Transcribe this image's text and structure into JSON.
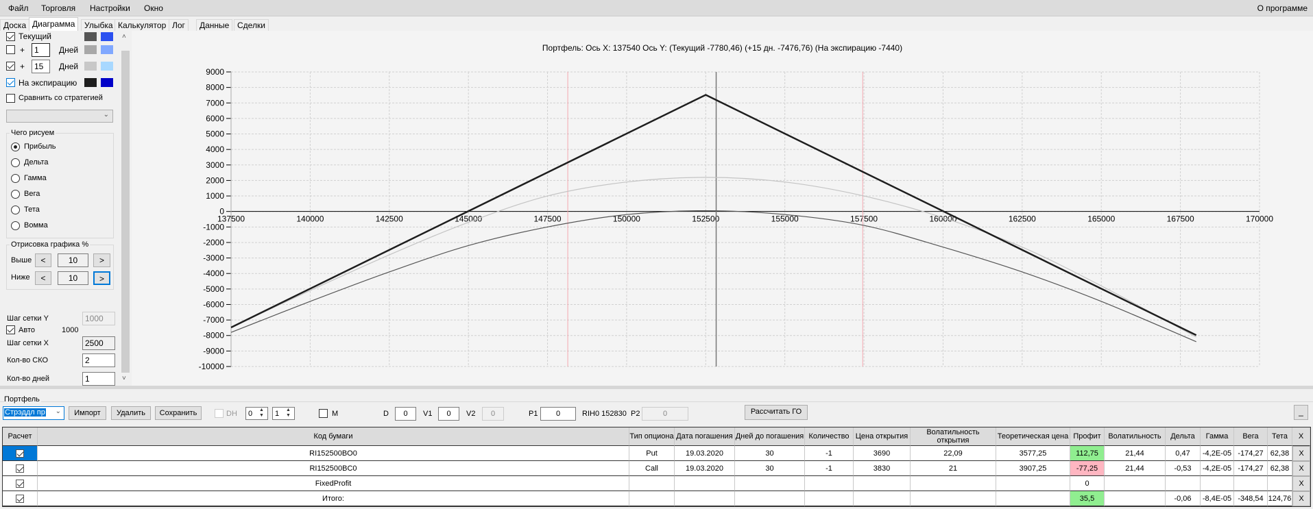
{
  "menu": {
    "items": [
      "Файл",
      "Торговля",
      "Настройки",
      "Окно"
    ],
    "about": "О программе"
  },
  "tabs": [
    "Доска",
    "Диаграмма",
    "Улыбка",
    "Калькулятор",
    "Лог",
    "Данные",
    "Сделки"
  ],
  "active_tab": "Диаграмма",
  "left": {
    "current_label": "Текущий",
    "plus": "+",
    "days1_value": "1",
    "days2_value": "15",
    "days_label": "Дней",
    "expiration_label": "На экспирацию",
    "compare_label": "Сравнить со стратегией",
    "colors": {
      "current": [
        "#555555",
        "#2b50f0"
      ],
      "days1": [
        "#a8a8a8",
        "#80a8ff"
      ],
      "days15": [
        "#c8c8c8",
        "#a8d8ff"
      ],
      "expiration": [
        "#1e1e1e",
        "#0000c8"
      ]
    },
    "what_group": "Чего рисуем",
    "radios": [
      "Прибыль",
      "Дельта",
      "Гамма",
      "Вега",
      "Тета",
      "Вомма"
    ],
    "radio_selected": "Прибыль",
    "draw_group": "Отрисовка графика %",
    "above_label": "Выше",
    "above_value": "10",
    "below_label": "Ниже",
    "below_value": "10",
    "prev": "<",
    "next": ">",
    "grid_y_label": "Шаг сетки Y",
    "grid_y_value": "1000",
    "auto_label": "Авто",
    "auto_value": "1000",
    "grid_x_label": "Шаг сетки X",
    "grid_x_value": "2500",
    "sko_label": "Кол-во СКО",
    "sko_value": "2",
    "days_count_label": "Кол-во дней",
    "days_count_value": "1"
  },
  "chart_data": {
    "type": "line",
    "title": "Портфель: Ось X: 137540 Ось Y:  (Текущий -7780,46)  (+15 дн. -7476,76)  (На экспирацию -7440)",
    "xlim": [
      137500,
      170000
    ],
    "ylim": [
      -10000,
      9000
    ],
    "xticks": [
      137500,
      140000,
      142500,
      145000,
      147500,
      150000,
      152500,
      155000,
      157500,
      160000,
      162500,
      165000,
      167500,
      170000
    ],
    "yticks": [
      9000,
      8000,
      7000,
      6000,
      5000,
      4000,
      3000,
      2000,
      1000,
      0,
      -1000,
      -2000,
      -3000,
      -4000,
      -5000,
      -6000,
      -7000,
      -8000,
      -9000,
      -10000
    ],
    "grid": true,
    "series": [
      {
        "key": "current",
        "color": "#555555",
        "x": [
          137500,
          140000,
          142500,
          145000,
          147500,
          150000,
          152500,
          155000,
          157500,
          160000,
          162500,
          165000,
          168000
        ],
        "y": [
          -7800,
          -5800,
          -3900,
          -2200,
          -1000,
          -200,
          50,
          -200,
          -900,
          -2300,
          -3900,
          -5800,
          -8400
        ]
      },
      {
        "key": "plus15",
        "color": "#c4c4c4",
        "x": [
          137500,
          140000,
          142500,
          145000,
          147500,
          150000,
          152500,
          155000,
          157500,
          160000,
          162500,
          165000,
          168000
        ],
        "y": [
          -7480,
          -5100,
          -2800,
          -700,
          1000,
          1900,
          2200,
          1900,
          1000,
          -400,
          -2300,
          -4800,
          -8100
        ]
      },
      {
        "key": "expiration",
        "color": "#1e1e1e",
        "x": [
          137500,
          152500,
          168000
        ],
        "y": [
          -7480,
          7520,
          -7980
        ]
      }
    ],
    "sd_lines": [
      148140,
      157460
    ],
    "price_line": 152830
  },
  "portfolio": {
    "label": "Портфель",
    "strategy": "Стрэддл пр",
    "import": "Импорт",
    "delete": "Удалить",
    "save": "Сохранить",
    "dh": "DH",
    "spin1": "0",
    "spin2": "1",
    "m": "M",
    "d_label": "D",
    "d_value": "0",
    "v1_label": "V1",
    "v1_value": "0",
    "v2_label": "V2",
    "v2_value": "0",
    "p1_label": "P1",
    "p1_value": "0",
    "ticker_price": "RIH0 152830",
    "p2_label": "P2",
    "p2_value": "0",
    "calc_go": "Рассчитать ГО",
    "minimize": "_"
  },
  "table": {
    "headers": [
      "Расчет",
      "Код бумаги",
      "Тип опциона",
      "Дата погашения",
      "Дней до погашения",
      "Количество",
      "Цена открытия",
      "Волатильность открытия",
      "Теоретическая цена",
      "Профит",
      "Волатильность",
      "Дельта",
      "Гамма",
      "Вега",
      "Тета",
      "X"
    ],
    "rows": [
      [
        "",
        "RI152500BO0",
        "Put",
        "19.03.2020",
        "30",
        "-1",
        "3690",
        "22,09",
        "3577,25",
        "112,75",
        "21,44",
        "0,47",
        "-4,2E-05",
        "-174,27",
        "62,38",
        "X"
      ],
      [
        "",
        "RI152500BC0",
        "Call",
        "19.03.2020",
        "30",
        "-1",
        "3830",
        "21",
        "3907,25",
        "-77,25",
        "21,44",
        "-0,53",
        "-4,2E-05",
        "-174,27",
        "62,38",
        "X"
      ],
      [
        "",
        "FixedProfit",
        "",
        "",
        "",
        "",
        "",
        "",
        "",
        "0",
        "",
        "",
        "",
        "",
        "",
        "X"
      ],
      [
        "",
        "Итого:",
        "",
        "",
        "",
        "",
        "",
        "",
        "",
        "35,5",
        "",
        "-0,06",
        "-8,4E-05",
        "-348,54",
        "124,76",
        "X"
      ]
    ],
    "profit_colors": [
      "#90ee90",
      "#ffb6c1",
      "#ffffff",
      "#90ee90"
    ]
  }
}
